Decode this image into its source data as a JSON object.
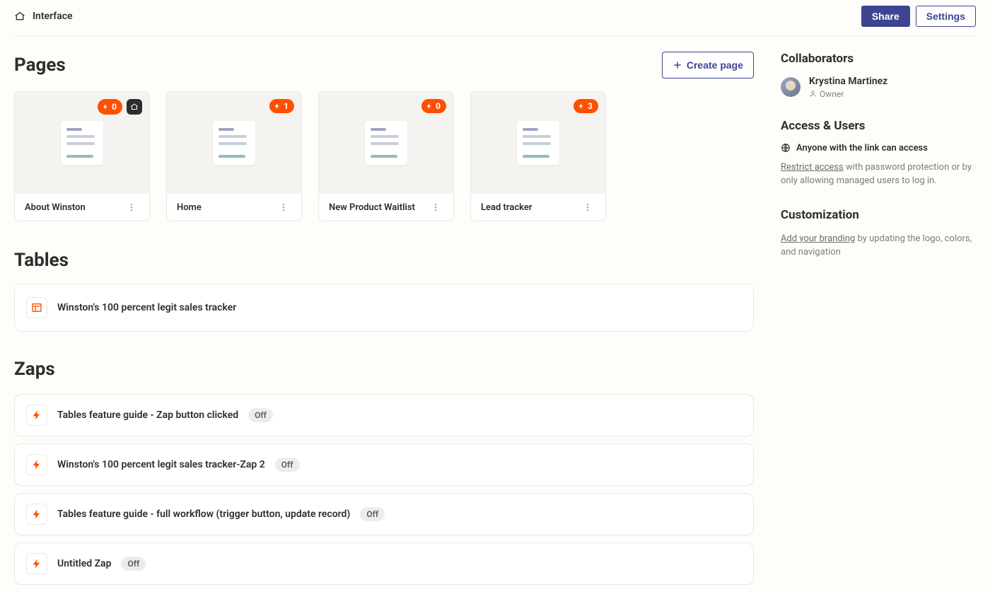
{
  "header": {
    "title": "Interface",
    "share_label": "Share",
    "settings_label": "Settings"
  },
  "pages_section": {
    "heading": "Pages",
    "create_label": "Create page",
    "cards": [
      {
        "title": "About Winston",
        "zap_count": "0",
        "home": true
      },
      {
        "title": "Home",
        "zap_count": "1",
        "home": false
      },
      {
        "title": "New Product Waitlist",
        "zap_count": "0",
        "home": false
      },
      {
        "title": "Lead tracker",
        "zap_count": "3",
        "home": false
      }
    ]
  },
  "tables_section": {
    "heading": "Tables",
    "rows": [
      {
        "title": "Winston's 100 percent legit sales tracker"
      }
    ]
  },
  "zaps_section": {
    "heading": "Zaps",
    "rows": [
      {
        "title": "Tables feature guide - Zap button clicked",
        "status": "Off"
      },
      {
        "title": "Winston's 100 percent legit sales tracker-Zap 2",
        "status": "Off"
      },
      {
        "title": "Tables feature guide - full workflow (trigger button, update record)",
        "status": "Off"
      },
      {
        "title": "Untitled Zap",
        "status": "Off"
      }
    ]
  },
  "sidebar": {
    "collaborators_heading": "Collaborators",
    "collab_name": "Krystina Martinez",
    "collab_role": "Owner",
    "access_heading": "Access & Users",
    "access_line": "Anyone with the link can access",
    "restrict_link": "Restrict access",
    "restrict_desc_rest": " with password protection or by only allowing managed users to log in.",
    "custom_heading": "Customization",
    "branding_link": "Add your branding",
    "branding_desc_rest": " by updating the logo, colors, and navigation"
  }
}
